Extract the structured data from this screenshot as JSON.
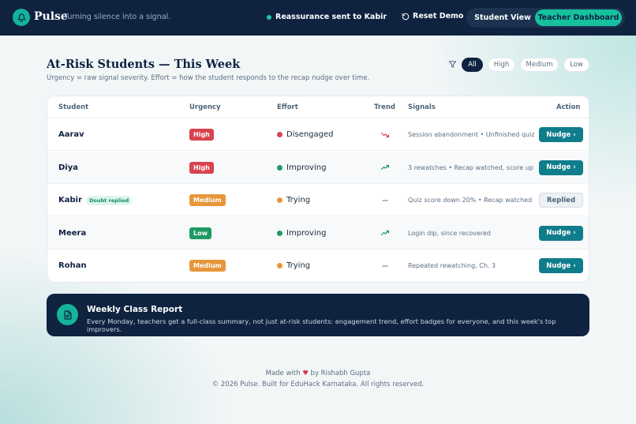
{
  "header": {
    "brand": "Pulse",
    "tagline": "Turning silence into a signal.",
    "status": "Reassurance sent to Kabir",
    "reset_label": "Reset Demo",
    "view_student": "Student View",
    "view_teacher": "Teacher Dashboard",
    "active_view": "Teacher Dashboard"
  },
  "page": {
    "title": "At-Risk Students — This Week",
    "subtitle": "Urgency = raw signal severity. Effort = how the student responds to the recap nudge over time."
  },
  "filters": {
    "options": [
      "All",
      "High",
      "Medium",
      "Low"
    ],
    "selected": "All"
  },
  "table": {
    "headers": [
      "Student",
      "Urgency",
      "Effort",
      "Trend",
      "Signals",
      "Action"
    ],
    "rows": [
      {
        "name": "Aarav",
        "badge": "",
        "urgency": "High",
        "effort": "Disengaged",
        "trend": "down",
        "signals": "Session abandonment • Unfinished quiz",
        "action": "Nudge ›"
      },
      {
        "name": "Diya",
        "badge": "",
        "urgency": "High",
        "effort": "Improving",
        "trend": "up",
        "signals": "3 rewatches • Recap watched, score up",
        "action": "Nudge ›"
      },
      {
        "name": "Kabir",
        "badge": "Doubt replied",
        "urgency": "Medium",
        "effort": "Trying",
        "trend": "flat",
        "signals": "Quiz score down 20% • Recap watched",
        "action": "Replied"
      },
      {
        "name": "Meera",
        "badge": "",
        "urgency": "Low",
        "effort": "Improving",
        "trend": "up",
        "signals": "Login dip, since recovered",
        "action": "Nudge ›"
      },
      {
        "name": "Rohan",
        "badge": "",
        "urgency": "Medium",
        "effort": "Trying",
        "trend": "flat",
        "signals": "Repeated rewatching, Ch. 3",
        "action": "Nudge ›"
      }
    ]
  },
  "colors": {
    "urgency": {
      "High": "#d8434f",
      "Medium": "#e8963a",
      "Low": "#1f9a62"
    },
    "effort": {
      "Disengaged": "#d8434f",
      "Improving": "#1f9a62",
      "Trying": "#e8963a"
    },
    "trend": {
      "down": "#d8434f",
      "up": "#1f9a62",
      "flat": "#7d8ea0"
    }
  },
  "report": {
    "title": "Weekly Class Report",
    "text": "Every Monday, teachers get a full-class summary, not just at-risk students: engagement trend, effort badges for everyone, and this week's top improvers."
  },
  "footer": {
    "made_prefix": "Made with",
    "heart": "♥",
    "made_suffix": "by Rishabh Gupta",
    "copyright": "© 2026 Pulse. Built for EduHack Karnataka. All rights reserved."
  }
}
